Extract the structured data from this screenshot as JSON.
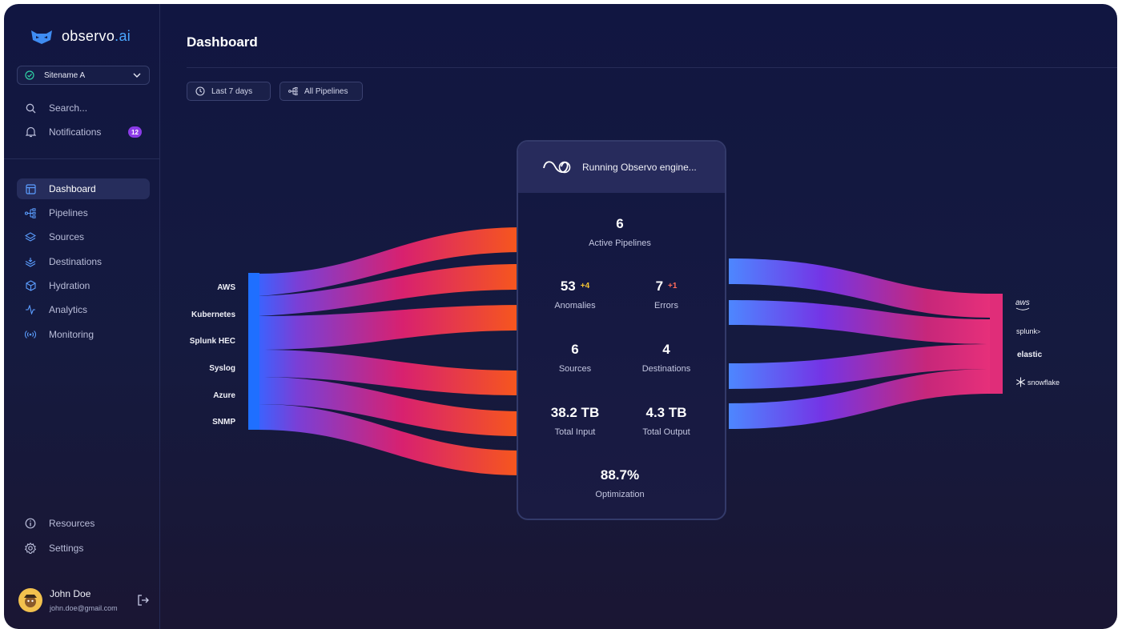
{
  "brand": {
    "name": "observo",
    "suffix": ".ai"
  },
  "site_selector": {
    "value": "Sitename A"
  },
  "sidebar": {
    "search_label": "Search...",
    "notifications_label": "Notifications",
    "notifications_count": "12",
    "items": [
      {
        "label": "Dashboard",
        "icon": "layout-icon",
        "active": true
      },
      {
        "label": "Pipelines",
        "icon": "pipeline-icon"
      },
      {
        "label": "Sources",
        "icon": "layers-up-icon"
      },
      {
        "label": "Destinations",
        "icon": "layers-down-icon"
      },
      {
        "label": "Hydration",
        "icon": "cube-icon"
      },
      {
        "label": "Analytics",
        "icon": "pulse-icon"
      },
      {
        "label": "Monitoring",
        "icon": "broadcast-icon"
      }
    ],
    "resources_label": "Resources",
    "settings_label": "Settings"
  },
  "user": {
    "name": "John Doe",
    "email": "john.doe@gmail.com"
  },
  "header": {
    "title": "Dashboard"
  },
  "filters": {
    "time_range": "Last 7 days",
    "pipelines": "All Pipelines"
  },
  "engine": {
    "status": "Running Observo engine...",
    "active_pipelines": {
      "value": "6",
      "label": "Active Pipelines"
    },
    "anomalies": {
      "value": "53",
      "delta": "+4",
      "label": "Anomalies"
    },
    "errors": {
      "value": "7",
      "delta": "+1",
      "label": "Errors"
    },
    "sources": {
      "value": "6",
      "label": "Sources"
    },
    "destinations": {
      "value": "4",
      "label": "Destinations"
    },
    "total_input": {
      "value": "38.2 TB",
      "label": "Total Input"
    },
    "total_output": {
      "value": "4.3 TB",
      "label": "Total Output"
    },
    "optimization": {
      "value": "88.7%",
      "label": "Optimization"
    }
  },
  "flow": {
    "sources": [
      "AWS",
      "Kubernetes",
      "Splunk HEC",
      "Syslog",
      "Azure",
      "SNMP"
    ],
    "destinations": [
      "aws",
      "splunk",
      "elastic",
      "snowflake"
    ],
    "colors": {
      "source_bar": "#1f6fff",
      "mid": "#d6246e",
      "end": "#f45a1e",
      "out_start": "#4f86ff",
      "out_mid": "#7b36e8",
      "out_end": "#e02d79"
    }
  }
}
